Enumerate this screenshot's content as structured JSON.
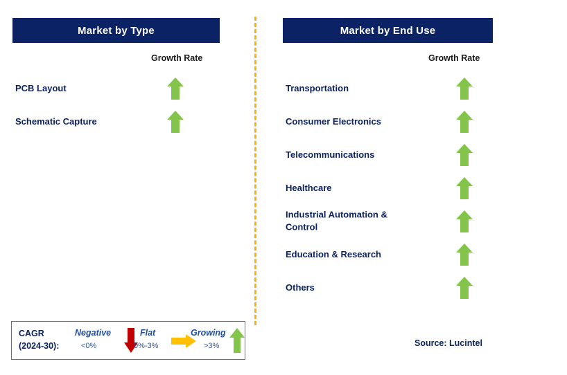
{
  "colors": {
    "header_bg": "#0b2265",
    "label_navy": "#0b2265",
    "arrow_growing": "#84c44a",
    "arrow_negative": "#c00000",
    "arrow_flat": "#ffc000",
    "divider_orange": "#f5b30c",
    "legend_border": "#6d6d6d",
    "legend_term": "#1f4e9c"
  },
  "panels": [
    {
      "id": "market-by-type",
      "title": "Market by Type",
      "growth_rate_label": "Growth Rate",
      "rows": [
        {
          "label": "PCB Layout",
          "growth": "Growing",
          "icon": "arrow-up-green-icon"
        },
        {
          "label": "Schematic Capture",
          "growth": "Growing",
          "icon": "arrow-up-green-icon"
        }
      ]
    },
    {
      "id": "market-by-end-use",
      "title": "Market by End Use",
      "growth_rate_label": "Growth Rate",
      "rows": [
        {
          "label": "Transportation",
          "growth": "Growing",
          "icon": "arrow-up-green-icon"
        },
        {
          "label": "Consumer Electronics",
          "growth": "Growing",
          "icon": "arrow-up-green-icon"
        },
        {
          "label": "Telecommunications",
          "growth": "Growing",
          "icon": "arrow-up-green-icon"
        },
        {
          "label": "Healthcare",
          "growth": "Growing",
          "icon": "arrow-up-green-icon"
        },
        {
          "label": "Industrial Automation &\nControl",
          "growth": "Growing",
          "icon": "arrow-up-green-icon"
        },
        {
          "label": "Education & Research",
          "growth": "Growing",
          "icon": "arrow-up-green-icon"
        },
        {
          "label": "Others",
          "growth": "Growing",
          "icon": "arrow-up-green-icon"
        }
      ]
    }
  ],
  "legend": {
    "cagr_label": "CAGR\n(2024-30):",
    "items": [
      {
        "term": "Negative",
        "range": "<0%",
        "icon": "arrow-down-red-icon"
      },
      {
        "term": "Flat",
        "range": "0%-3%",
        "icon": "arrow-right-yellow-icon"
      },
      {
        "term": "Growing",
        "range": ">3%",
        "icon": "arrow-up-green-icon"
      }
    ]
  },
  "source": "Source: Lucintel"
}
